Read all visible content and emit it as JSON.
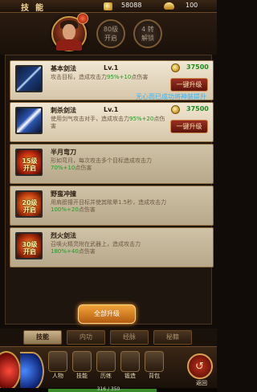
{
  "topbar": {
    "title": "技能",
    "gold": "58088",
    "ingot": "100"
  },
  "header": {
    "badges": [
      {
        "line1": "80级",
        "line2": "开启"
      },
      {
        "line1": "4 转",
        "line2": "解锁"
      }
    ]
  },
  "skills": [
    {
      "name": "基本剑法",
      "level": "Lv.1",
      "desc_prefix": "攻击目标，造成攻击力",
      "desc_hl": "95%+10",
      "desc_suffix": "点伤害",
      "cost": "37500",
      "button": "一键升级",
      "icon": "sword-icon"
    },
    {
      "name": "刺杀剑法",
      "level": "Lv.1",
      "desc_prefix": "使用剑气攻击对手，造成攻击力",
      "desc_hl": "95%+20",
      "desc_suffix": "点伤害",
      "cost": "37500",
      "button": "一键升级",
      "icon": "stab-icon"
    },
    {
      "name": "半月弯刀",
      "level": "",
      "desc_prefix": "形如弯月，每次攻击多个目标造成攻击力",
      "desc_hl": "70%+10",
      "desc_suffix": "点伤害",
      "icon_text": "15级\n开启",
      "icon": "moon-blade-icon"
    },
    {
      "name": "野蛮冲撞",
      "level": "",
      "desc_prefix": "用肩膀撞开目标并使其眩晕1.5秒，造成攻击力",
      "desc_hl": "100%+20",
      "desc_suffix": "点伤害",
      "icon_text": "20级\n开启",
      "icon": "rush-icon"
    },
    {
      "name": "烈火剑法",
      "level": "",
      "desc_prefix": "召唤火精灵附在武器上，造成攻击力",
      "desc_hl": "180%+40",
      "desc_suffix": "点伤害",
      "icon_text": "30级\n开启",
      "icon": "fire-sword-icon"
    }
  ],
  "notice": "无心而已成功将神装提升",
  "all_upgrade": "全部升级",
  "tabs": [
    "技能",
    "内功",
    "经脉",
    "秘籍"
  ],
  "nav": [
    "人物",
    "技能",
    "历练",
    "锻造",
    "背包"
  ],
  "back": "返回",
  "exp": {
    "text": "316 / 350",
    "fraction": 0.9
  }
}
